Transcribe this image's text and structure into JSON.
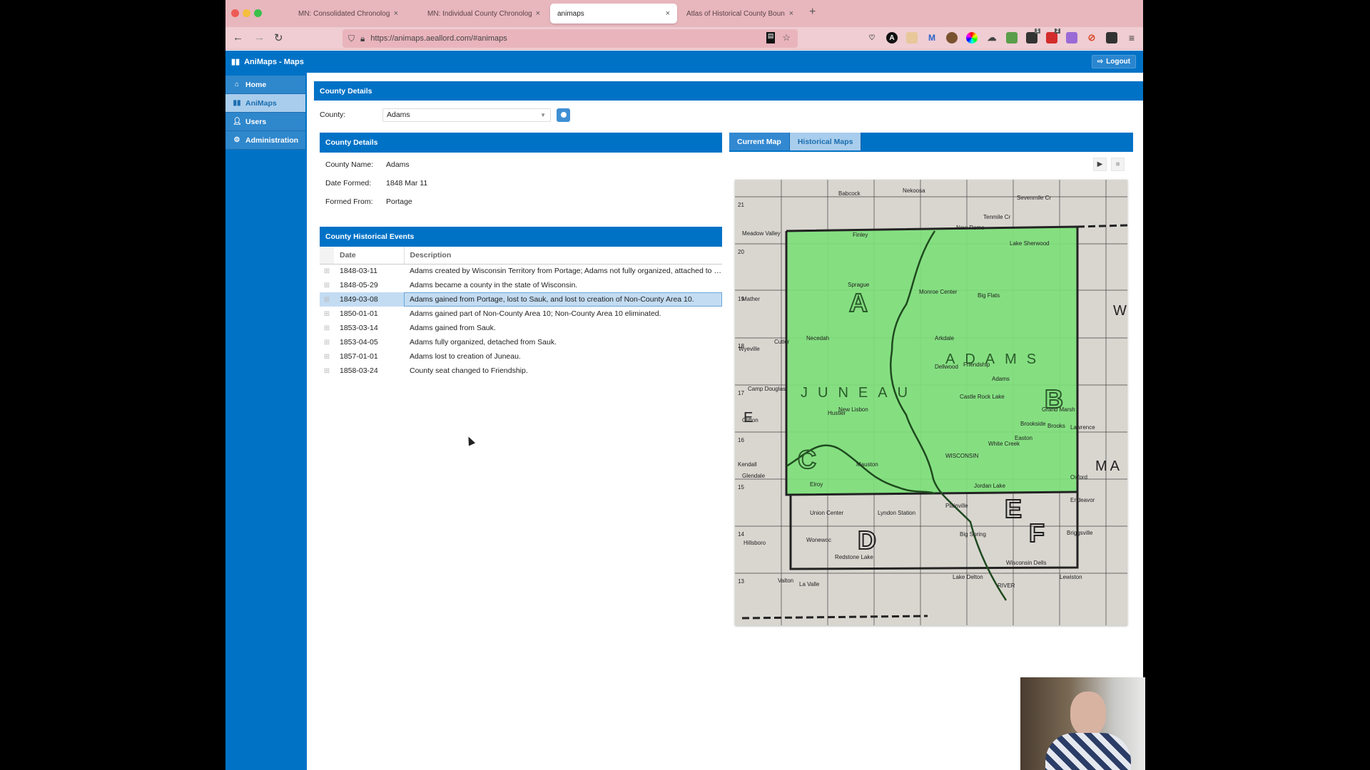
{
  "browser": {
    "tabs": [
      {
        "label": "MN: Consolidated Chronology",
        "active": false
      },
      {
        "label": "MN: Individual County Chronologies",
        "active": false
      },
      {
        "label": "animaps",
        "active": true
      },
      {
        "label": "Atlas of Historical County Boundaries",
        "active": false
      }
    ],
    "new_tab_glyph": "+",
    "close_glyph": "×",
    "url": "https://animaps.aeallord.com/#animaps",
    "extension_badges": {
      "ext9": "1",
      "ext10": "2"
    },
    "menu_glyph": "≡"
  },
  "app": {
    "title": "AniMaps - Maps",
    "logout_label": "Logout"
  },
  "sidebar": {
    "items": [
      {
        "label": "Home",
        "icon": "home-icon",
        "active": false
      },
      {
        "label": "AniMaps",
        "icon": "map-icon",
        "active": true
      },
      {
        "label": "Users",
        "icon": "users-icon",
        "active": false
      },
      {
        "label": "Administration",
        "icon": "gear-icon",
        "active": false
      }
    ]
  },
  "main": {
    "header": "County Details",
    "county_label": "County:",
    "county_value": "Adams",
    "details": {
      "header": "County Details",
      "rows": [
        {
          "key": "County Name:",
          "value": "Adams"
        },
        {
          "key": "Date Formed:",
          "value": "1848 Mar 11"
        },
        {
          "key": "Formed From:",
          "value": "Portage"
        }
      ]
    },
    "events": {
      "header": "County Historical Events",
      "columns": [
        "Date",
        "Description"
      ],
      "selected_index": 2,
      "rows": [
        {
          "date": "1848-03-11",
          "description": "Adams created by Wisconsin Territory from Portage; Adams not fully organized, attached to S..."
        },
        {
          "date": "1848-05-29",
          "description": "Adams became a county in the state of Wisconsin."
        },
        {
          "date": "1849-03-08",
          "description": "Adams gained from Portage, lost to Sauk, and lost to creation of Non-County Area 10."
        },
        {
          "date": "1850-01-01",
          "description": "Adams gained part of Non-County Area 10; Non-County Area 10 eliminated."
        },
        {
          "date": "1853-03-14",
          "description": "Adams gained from Sauk."
        },
        {
          "date": "1853-04-05",
          "description": "Adams fully organized, detached from Sauk."
        },
        {
          "date": "1857-01-01",
          "description": "Adams lost to creation of Juneau."
        },
        {
          "date": "1858-03-24",
          "description": "County seat changed to Friendship."
        }
      ]
    },
    "map": {
      "tabs": [
        {
          "label": "Current Map",
          "active": false
        },
        {
          "label": "Historical Maps",
          "active": true
        }
      ],
      "play_glyph": "▶",
      "stop_glyph": "■",
      "highlight_color": "#7ee07a",
      "labels": {
        "big_letters": [
          "A",
          "B",
          "C",
          "D",
          "E",
          "F"
        ],
        "counties": [
          "ADAMS",
          "JUNEAU"
        ],
        "edge_letters": [
          "W",
          "E",
          "MA"
        ],
        "places": [
          "Babcock",
          "Nekoosa",
          "Sevenmile Cr",
          "Tenmile Cr",
          "New Rome",
          "Lake Sherwood",
          "Meadow Valley",
          "Finley",
          "Sprague",
          "Mather",
          "Monroe Center",
          "Big Flats",
          "Wyeville",
          "Cutler",
          "Necedah",
          "Arkdale",
          "Dellwood",
          "Friendship",
          "Adams",
          "Camp Douglas",
          "Castle Rock Lake",
          "Grand Marsh",
          "Hustler",
          "New Lisbon",
          "Brookside",
          "Easton",
          "Brooks",
          "White Creek",
          "Mauston",
          "Clifton",
          "Kendall",
          "Glendale",
          "Elroy",
          "Union Center",
          "Wonewoc",
          "Hillsboro",
          "Lyndon Station",
          "Plainville",
          "Jordan Lake",
          "Big Spring",
          "Wisconsin Dells",
          "Briggsville",
          "Oxford",
          "Endeavor",
          "Lawrence",
          "Redstone Lake",
          "Valton",
          "La Valle",
          "Lake Delton",
          "Lewiston",
          "RIVER",
          "WISCONSIN"
        ],
        "township_numbers": [
          "21",
          "20",
          "19",
          "18",
          "17",
          "16",
          "15",
          "14",
          "13"
        ]
      }
    }
  }
}
